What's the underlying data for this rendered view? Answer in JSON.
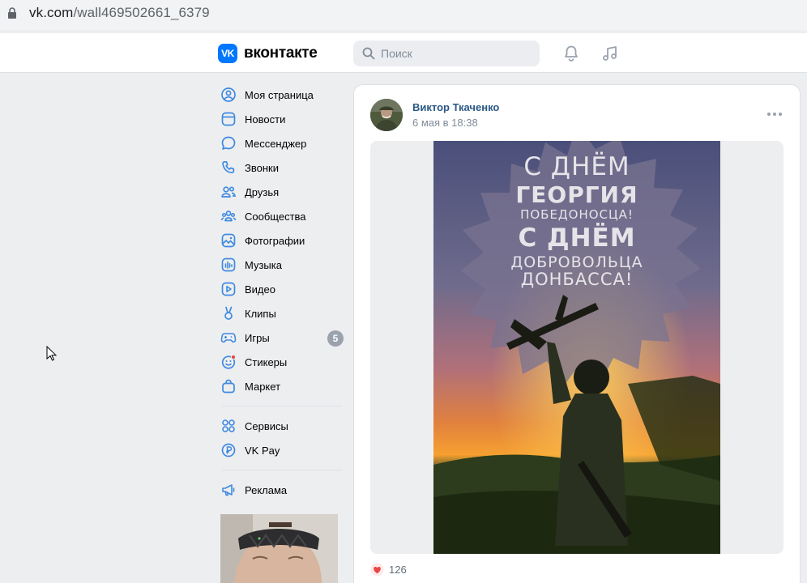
{
  "browser": {
    "url_host": "vk.com",
    "url_path": "/wall469502661_6379"
  },
  "header": {
    "logo_text": "вконтакте",
    "search_placeholder": "Поиск",
    "accent": "#0077ff"
  },
  "nav": {
    "items": [
      {
        "label": "Моя страница",
        "icon": "user-circle-icon"
      },
      {
        "label": "Новости",
        "icon": "newsfeed-icon"
      },
      {
        "label": "Мессенджер",
        "icon": "message-icon"
      },
      {
        "label": "Звонки",
        "icon": "phone-icon"
      },
      {
        "label": "Друзья",
        "icon": "friends-icon"
      },
      {
        "label": "Сообщества",
        "icon": "communities-icon"
      },
      {
        "label": "Фотографии",
        "icon": "photos-icon"
      },
      {
        "label": "Музыка",
        "icon": "music-icon"
      },
      {
        "label": "Видео",
        "icon": "video-icon"
      },
      {
        "label": "Клипы",
        "icon": "clips-icon"
      },
      {
        "label": "Игры",
        "icon": "gamepad-icon",
        "badge": "5"
      },
      {
        "label": "Стикеры",
        "icon": "sticker-icon"
      },
      {
        "label": "Маркет",
        "icon": "market-bag-icon"
      }
    ],
    "secondary": [
      {
        "label": "Сервисы",
        "icon": "services-grid-icon"
      },
      {
        "label": "VK Pay",
        "icon": "vkpay-icon"
      }
    ],
    "tertiary": [
      {
        "label": "Реклама",
        "icon": "megaphone-icon"
      }
    ]
  },
  "post": {
    "author": "Виктор Ткаченко",
    "date": "6 мая в 18:38",
    "image_text": {
      "line1": "С ДНЁМ",
      "line2": "ГЕОРГИЯ",
      "line3": "ПОБЕДОНОСЦА!",
      "line4": "С ДНЁМ",
      "line5": "ДОБРОВОЛЬЦА",
      "line6": "ДОНБАССА!"
    },
    "likes": "126",
    "like_color": "#e64646"
  }
}
